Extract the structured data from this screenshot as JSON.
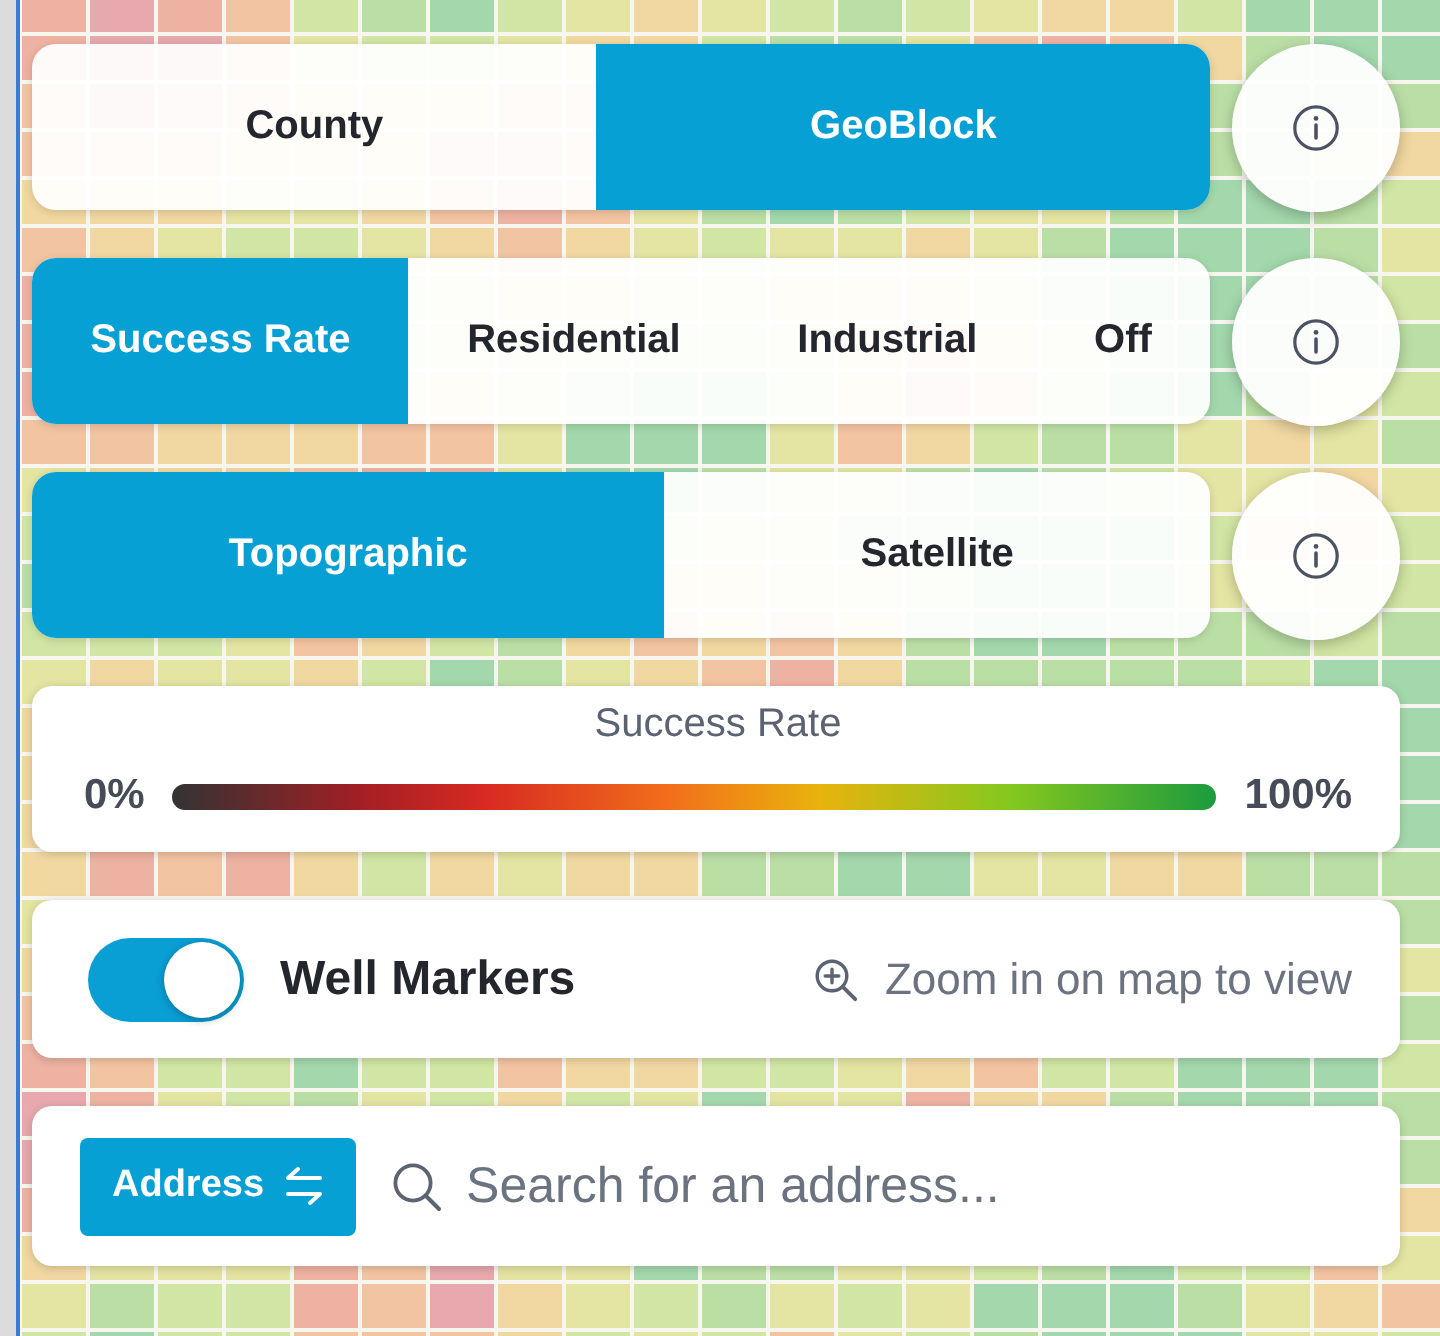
{
  "map_controls": [
    {
      "options": [
        {
          "label": "County",
          "selected": false
        },
        {
          "label": "GeoBlock",
          "selected": true
        }
      ]
    },
    {
      "options": [
        {
          "label": "Success Rate",
          "selected": true
        },
        {
          "label": "Residential",
          "selected": false
        },
        {
          "label": "Industrial",
          "selected": false
        },
        {
          "label": "Off",
          "selected": false
        }
      ]
    },
    {
      "options": [
        {
          "label": "Topographic",
          "selected": true
        },
        {
          "label": "Satellite",
          "selected": false
        }
      ]
    }
  ],
  "legend": {
    "title": "Success Rate",
    "min_label": "0%",
    "max_label": "100%"
  },
  "well_markers": {
    "label": "Well Markers",
    "on": true,
    "hint": "Zoom in on map to view"
  },
  "search": {
    "mode": "Address",
    "placeholder": "Search for an address..."
  }
}
